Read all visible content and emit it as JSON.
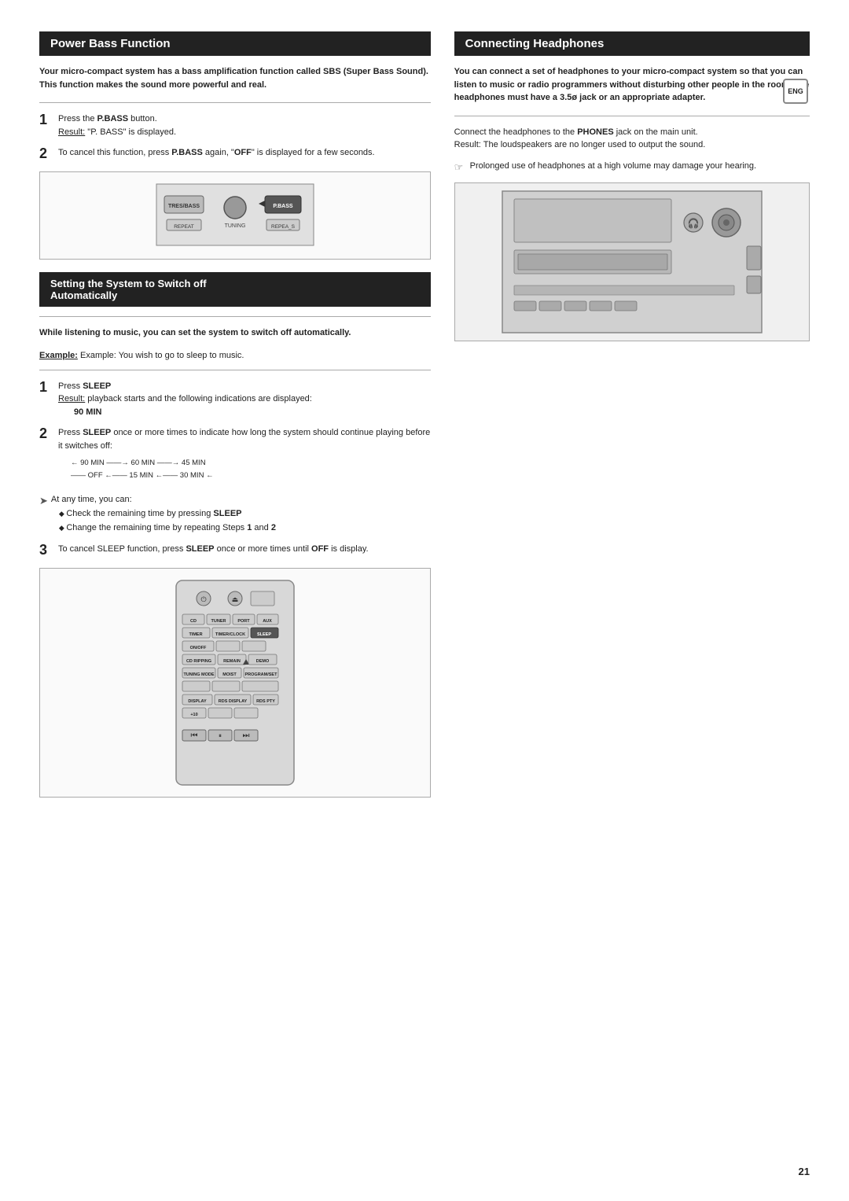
{
  "page": {
    "number": "21"
  },
  "eng_badge": "ENG",
  "power_bass": {
    "header": "Power Bass Function",
    "intro": "Your micro-compact system has a bass amplification function called SBS (Super Bass Sound). This function makes the sound more powerful and real.",
    "step1": {
      "num": "1",
      "text": "Press the ",
      "bold": "P.BASS",
      "text2": " button.",
      "result_label": "Result:",
      "result_text": " \"P. BASS\" is displayed."
    },
    "step2": {
      "num": "2",
      "text": "To cancel this function, press ",
      "bold1": "P.BASS",
      "text2": " again, \"",
      "bold2": "OFF",
      "text3": "\" is displayed for a few seconds."
    }
  },
  "setting_auto": {
    "header_line1": "Setting the System to Switch off",
    "header_line2": "Automatically",
    "intro_bold": "While listening to music, you can set the system to switch off automatically.",
    "intro_example": "Example: You wish to go to sleep to music.",
    "step1": {
      "num": "1",
      "text": "Press ",
      "bold": "SLEEP",
      "result_label": "Result:",
      "result_text": " playback starts and the following indications are displayed:",
      "result_bold": "90 MIN"
    },
    "step2": {
      "num": "2",
      "text": "Press ",
      "bold": "SLEEP",
      "text2": " once or more times to indicate how long the system should continue playing before it switches off:",
      "arrows_row1": "← 90 MIN —→ 60 MIN —→ 45 MIN",
      "arrows_row2": "— OFF ←— 15 MIN ←— 30 MIN ←"
    },
    "at_any_time": "At any time, you can:",
    "bullet1_text": "Check the remaining time by pressing ",
    "bullet1_bold": "SLEEP",
    "bullet2_text": "Change the remaining time by repeating Steps ",
    "bullet2_bold": "1",
    "bullet2_and": " and ",
    "bullet2_bold2": "2",
    "step3": {
      "num": "3",
      "text": "To cancel SLEEP function, press ",
      "bold": "SLEEP",
      "text2": " once or more times until ",
      "bold2": "OFF",
      "text3": " is display."
    }
  },
  "connecting_headphones": {
    "header": "Connecting Headphones",
    "intro": "You can connect a set of headphones to your micro-compact system so that you can listen to music or radio programmers without disturbing other people in the room. The headphones must have a 3.5ø jack or an appropriate adapter.",
    "step1_label": "Connect the headphones to the ",
    "step1_bold": "PHONES",
    "step1_text": " jack on the main unit.",
    "result_label": "Result:",
    "result_text": " The loudspeakers are no longer used to output the sound.",
    "note_icon": "☞",
    "note_text": "Prolonged use of headphones at a high volume may damage your hearing."
  },
  "remote_diagram": {
    "buttons": [
      {
        "label": "⏻",
        "type": "round"
      },
      {
        "label": "⏏",
        "type": "round"
      },
      {
        "label": "",
        "type": "square"
      },
      {
        "label": "CD",
        "type": "square"
      },
      {
        "label": "TUNER",
        "type": "square"
      },
      {
        "label": "PORT",
        "type": "square"
      },
      {
        "label": "AUX",
        "type": "square"
      },
      {
        "label": "TIMER",
        "type": "square"
      },
      {
        "label": "TIMER/CLOCK",
        "type": "square"
      },
      {
        "label": "SLEEP",
        "type": "square"
      },
      {
        "label": "ON/OFF",
        "type": "square"
      },
      {
        "label": "",
        "type": "square"
      },
      {
        "label": "",
        "type": "square"
      },
      {
        "label": "CD RIPPING",
        "type": "square"
      },
      {
        "label": "REMAIN",
        "type": "square"
      },
      {
        "label": "DEMO",
        "type": "square"
      },
      {
        "label": "TUNING MODE",
        "type": "square"
      },
      {
        "label": "MOIST",
        "type": "square"
      },
      {
        "label": "PROGRAM/SET",
        "type": "square"
      },
      {
        "label": "",
        "type": "square"
      },
      {
        "label": "",
        "type": "square"
      },
      {
        "label": "",
        "type": "square"
      },
      {
        "label": "DISPLAY",
        "type": "square"
      },
      {
        "label": "RDS DISPLAY",
        "type": "square"
      },
      {
        "label": "RDS PTY",
        "type": "square"
      },
      {
        "label": "+10",
        "type": "square"
      },
      {
        "label": "",
        "type": "square"
      },
      {
        "label": "",
        "type": "square"
      }
    ]
  }
}
